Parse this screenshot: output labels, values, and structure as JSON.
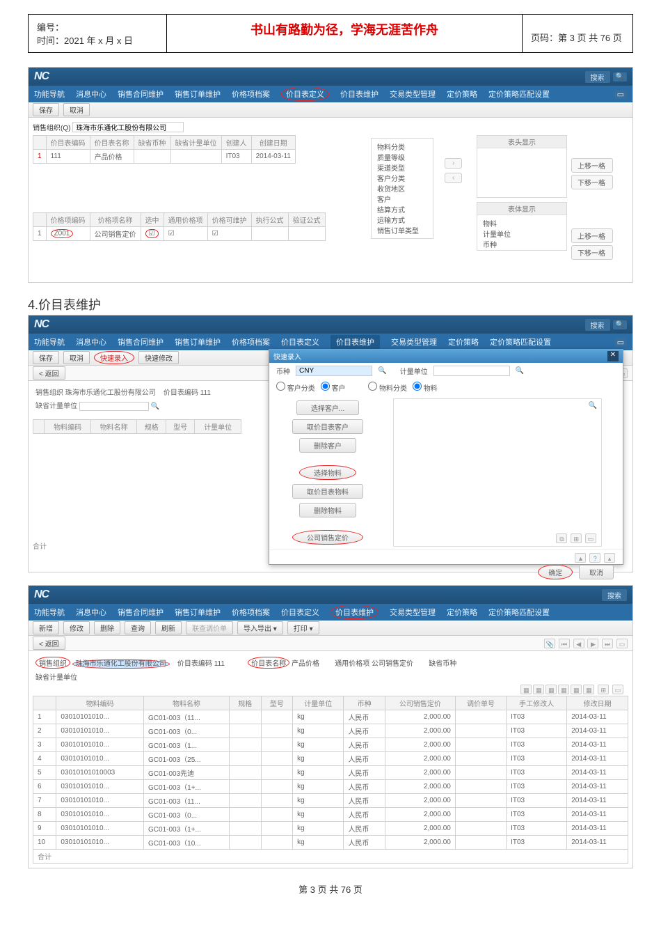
{
  "doc": {
    "id_label": "编号：",
    "time_label": "时间：2021 年 x 月 x 日",
    "motto": "书山有路勤为径，学海无涯苦作舟",
    "page_label": "页码：第 3 页 共 76 页",
    "footer": "第 3 页 共 76 页"
  },
  "section4_title": "4.价目表维护",
  "common": {
    "logo": "NC",
    "search": "搜索"
  },
  "nav_items": [
    "功能导航",
    "消息中心",
    "销售合同维护",
    "销售订单维护",
    "价格项档案",
    "价目表定义",
    "价目表维护",
    "交易类型管理",
    "定价策略",
    "定价策略匹配设置"
  ],
  "app1": {
    "toolbar": {
      "save": "保存",
      "cancel": "取消"
    },
    "org_label": "销售组织(Q)",
    "org_value": "珠海市乐通化工股份有限公司",
    "grid1_headers": [
      "价目表编码",
      "价目表名称",
      "缺省币种",
      "缺省计量单位",
      "创建人",
      "创建日期"
    ],
    "grid1_row": {
      "idx": "1",
      "code": "111",
      "name": "产品价格",
      "creator": "IT03",
      "date": "2014-03-11"
    },
    "left_list": [
      "物料分类",
      "质量等级",
      "渠道类型",
      "客户分类",
      "收货地区",
      "客户",
      "结算方式",
      "运输方式",
      "销售订单类型"
    ],
    "head_show": "表头显示",
    "body_show": "表体显示",
    "body_list": [
      "物料",
      "计量单位",
      "币种"
    ],
    "move_up": "上移一格",
    "move_down": "下移一格",
    "grid2_headers": [
      "价格项编码",
      "价格项名称",
      "选中",
      "通用价格项",
      "价格可维护",
      "执行公式",
      "验证公式"
    ],
    "grid2_row": {
      "idx": "1",
      "code": "Z001",
      "name": "公司销售定价",
      "chk1": "☑",
      "chk2": "☑",
      "chk3": "☑"
    }
  },
  "app2": {
    "toolbar": {
      "save": "保存",
      "cancel": "取消",
      "quick_entry": "快速录入",
      "quick_modify": "快速修改"
    },
    "back": "< 返回",
    "org_label": "销售组织",
    "org_value": "珠海市乐通化工股份有限公司",
    "code_label": "价目表编码",
    "code_value": "111",
    "unit_label": "缺省计量单位",
    "grid_headers": [
      "物料编码",
      "物料名称",
      "规格",
      "型号",
      "计量单位"
    ],
    "total": "合计",
    "dlg": {
      "title": "快速录入",
      "currency_label": "币种",
      "currency_value": "CNY",
      "unit_label": "计量单位",
      "cust_cat": "客户分类",
      "cust": "客户",
      "mat_cat": "物料分类",
      "mat": "物料",
      "sel_cust": "选择客户...",
      "price_cust": "取价目表客户",
      "del_cust": "删除客户",
      "sel_mat": "选择物料",
      "price_mat": "取价目表物料",
      "del_mat": "删除物料",
      "company_price": "公司销售定价",
      "ok": "确定",
      "cancel": "取消"
    }
  },
  "app3": {
    "toolbar": {
      "new": "新增",
      "edit": "修改",
      "del": "删除",
      "query": "查询",
      "refresh": "刷新",
      "link": "联查调价单",
      "io": "导入导出",
      "print": "打印"
    },
    "back": "< 返回",
    "org_label": "销售组织",
    "org_value": "珠海市乐通化工股份有限公司",
    "code_label": "价目表编码",
    "code_value": "111",
    "name_label": "价目表名称",
    "name_value": "产品价格",
    "item_label": "通用价格项",
    "item_value": "公司销售定价",
    "curr_label": "缺省币种",
    "unit_label": "缺省计量单位",
    "grid_headers": [
      "",
      "物料编码",
      "物料名称",
      "规格",
      "型号",
      "计量单位",
      "币种",
      "公司销售定价",
      "调价单号",
      "手工修改人",
      "修改日期"
    ],
    "rows": [
      {
        "n": "1",
        "code": "03010101010...",
        "name": "GC01-003（11...",
        "unit": "kg",
        "curr": "人民币",
        "price": "2,000.00",
        "mod": "IT03",
        "date": "2014-03-11"
      },
      {
        "n": "2",
        "code": "03010101010...",
        "name": "GC01-003（0...",
        "unit": "kg",
        "curr": "人民币",
        "price": "2,000.00",
        "mod": "IT03",
        "date": "2014-03-11"
      },
      {
        "n": "3",
        "code": "03010101010...",
        "name": "GC01-003（1...",
        "unit": "kg",
        "curr": "人民币",
        "price": "2,000.00",
        "mod": "IT03",
        "date": "2014-03-11"
      },
      {
        "n": "4",
        "code": "03010101010...",
        "name": "GC01-003（25...",
        "unit": "kg",
        "curr": "人民币",
        "price": "2,000.00",
        "mod": "IT03",
        "date": "2014-03-11"
      },
      {
        "n": "5",
        "code": "03010101010003",
        "name": "GC01-003先迪",
        "unit": "kg",
        "curr": "人民币",
        "price": "2,000.00",
        "mod": "IT03",
        "date": "2014-03-11"
      },
      {
        "n": "6",
        "code": "03010101010...",
        "name": "GC01-003（1+...",
        "unit": "kg",
        "curr": "人民币",
        "price": "2,000.00",
        "mod": "IT03",
        "date": "2014-03-11"
      },
      {
        "n": "7",
        "code": "03010101010...",
        "name": "GC01-003（11...",
        "unit": "kg",
        "curr": "人民币",
        "price": "2,000.00",
        "mod": "IT03",
        "date": "2014-03-11"
      },
      {
        "n": "8",
        "code": "03010101010...",
        "name": "GC01-003（0...",
        "unit": "kg",
        "curr": "人民币",
        "price": "2,000.00",
        "mod": "IT03",
        "date": "2014-03-11"
      },
      {
        "n": "9",
        "code": "03010101010...",
        "name": "GC01-003（1+...",
        "unit": "kg",
        "curr": "人民币",
        "price": "2,000.00",
        "mod": "IT03",
        "date": "2014-03-11"
      },
      {
        "n": "10",
        "code": "03010101010...",
        "name": "GC01-003（10...",
        "unit": "kg",
        "curr": "人民币",
        "price": "2,000.00",
        "mod": "IT03",
        "date": "2014-03-11"
      }
    ],
    "total": "合计"
  }
}
